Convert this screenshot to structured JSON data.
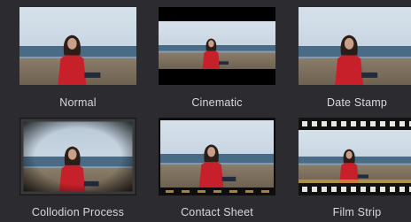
{
  "theme_gallery": {
    "items": [
      {
        "name": "Normal",
        "style": "normal"
      },
      {
        "name": "Cinematic",
        "style": "cinematic"
      },
      {
        "name": "Date Stamp",
        "style": "datestamp"
      },
      {
        "name": "Collodion Process",
        "style": "collodion"
      },
      {
        "name": "Contact Sheet",
        "style": "contactsheet"
      },
      {
        "name": "Film Strip",
        "style": "filmstrip"
      }
    ]
  },
  "colors": {
    "background": "#2c2b2f",
    "label_text": "#d9d9db",
    "sky": "#c9d6e2",
    "sea": "#4a6b85",
    "beach": "#6e6252",
    "sweater": "#c8202a"
  }
}
